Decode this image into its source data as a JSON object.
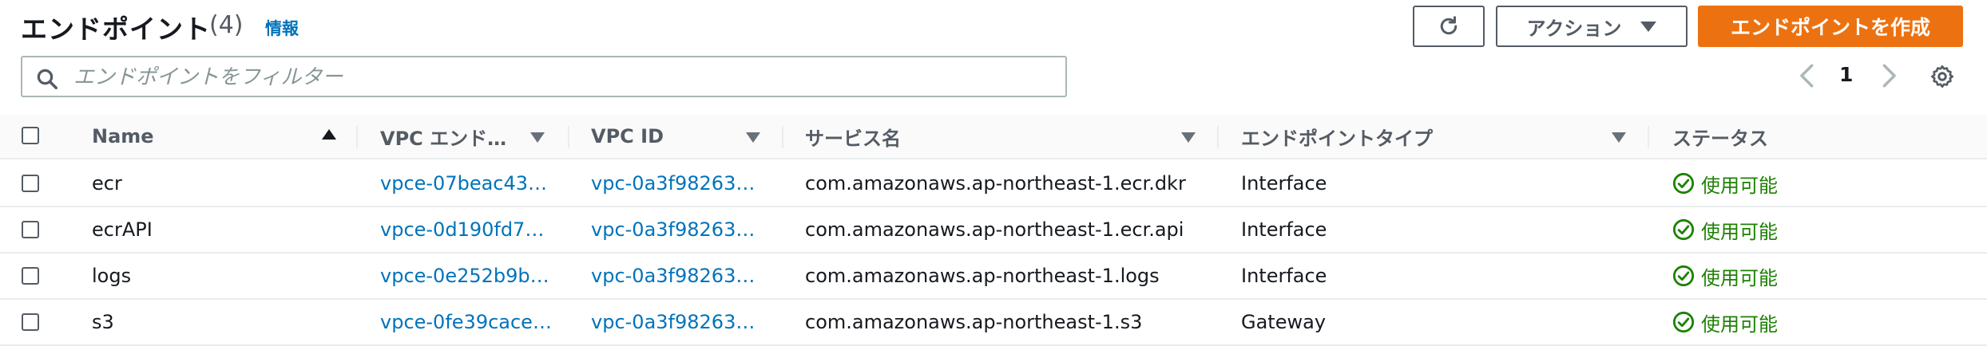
{
  "header": {
    "title": "エンドポイント",
    "count": "(4)",
    "info_link": "情報",
    "actions_label": "アクション",
    "create_label": "エンドポイントを作成"
  },
  "filter": {
    "placeholder": "エンドポイントをフィルター",
    "value": ""
  },
  "pagination": {
    "current_page": "1"
  },
  "icons": {
    "refresh": "refresh-icon",
    "search": "search-icon",
    "settings": "gear-icon",
    "status_ok": "check-circle-icon"
  },
  "colors": {
    "primary_orange": "#ec7211",
    "link_blue": "#0073bb",
    "status_green": "#1d8102"
  },
  "table": {
    "columns": [
      "Name",
      "VPC エンド…",
      "VPC ID",
      "サービス名",
      "エンドポイントタイプ",
      "ステータス"
    ],
    "rows": [
      {
        "name": "ecr",
        "vpce": "vpce-07beac43…",
        "vpc_id": "vpc-0a3f98263…",
        "service": "com.amazonaws.ap-northeast-1.ecr.dkr",
        "type": "Interface",
        "status": "使用可能"
      },
      {
        "name": "ecrAPI",
        "vpce": "vpce-0d190fd7…",
        "vpc_id": "vpc-0a3f98263…",
        "service": "com.amazonaws.ap-northeast-1.ecr.api",
        "type": "Interface",
        "status": "使用可能"
      },
      {
        "name": "logs",
        "vpce": "vpce-0e252b9b…",
        "vpc_id": "vpc-0a3f98263…",
        "service": "com.amazonaws.ap-northeast-1.logs",
        "type": "Interface",
        "status": "使用可能"
      },
      {
        "name": "s3",
        "vpce": "vpce-0fe39cace…",
        "vpc_id": "vpc-0a3f98263…",
        "service": "com.amazonaws.ap-northeast-1.s3",
        "type": "Gateway",
        "status": "使用可能"
      }
    ]
  }
}
